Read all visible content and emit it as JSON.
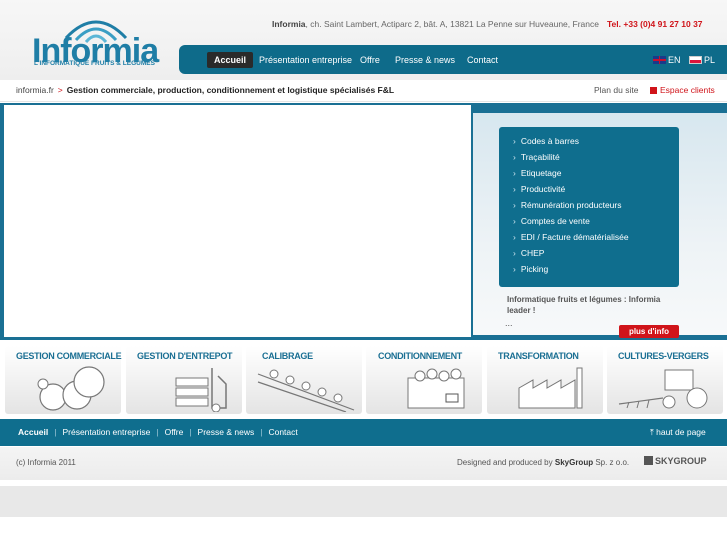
{
  "brand": {
    "name": "Informia",
    "tagline": "L'INFORMATIQUE FRUITS & LÉGUMES",
    "color": "#1f7ea6"
  },
  "header": {
    "address_bold": "Informia",
    "address_rest": ", ch. Saint Lambert, Actiparc 2, bât. A, 13821 La Penne sur Huveaune, France",
    "phone": "Tel. +33 (0)4 91 27 10 37"
  },
  "nav": {
    "items": [
      "Accueil",
      "Présentation entreprise",
      "Offre",
      "Presse & news",
      "Contact"
    ],
    "languages": [
      "EN",
      "PL"
    ]
  },
  "breadcrumb": {
    "home": "informia.fr",
    "separator": ">",
    "title": "Gestion commerciale, production, conditionnement et logistique spécialisés F&L"
  },
  "utility": {
    "site_map": "Plan du site",
    "client_space": "Espace clients"
  },
  "services": [
    "Codes à barres",
    "Traçabilité",
    "Etiquetage",
    "Productivité",
    "Rémunération producteurs",
    "Comptes de vente",
    "EDI / Facture dématérialisée",
    "CHEP",
    "Picking"
  ],
  "promo": {
    "text": "Informatique fruits et légumes : Informia leader !",
    "ellipsis": "...",
    "button": "plus d'info"
  },
  "categories": [
    {
      "title": "GESTION COMMERCIALE",
      "icon": "tomatoes-icon"
    },
    {
      "title": "GESTION D'ENTREPOT",
      "icon": "forklift-icon"
    },
    {
      "title": "CALIBRAGE",
      "icon": "conveyor-icon"
    },
    {
      "title": "CONDITIONNEMENT",
      "icon": "crate-icon"
    },
    {
      "title": "TRANSFORMATION",
      "icon": "factory-icon"
    },
    {
      "title": "CULTURES-VERGERS",
      "icon": "tractor-icon"
    }
  ],
  "footer_nav": {
    "items": [
      "Accueil",
      "Présentation entreprise",
      "Offre",
      "Presse & news",
      "Contact"
    ],
    "back_to_top": "haut de page"
  },
  "footer": {
    "copyright": "(c) Informia 2011",
    "designed_prefix": "Designed and produced by ",
    "designed_company": "SkyGroup",
    "designed_suffix": " Sp. z o.o.",
    "partner_logo": "SKYGROUP"
  },
  "colors": {
    "nav_blue": "#0e6b8a",
    "accent_red": "#d0141a"
  }
}
